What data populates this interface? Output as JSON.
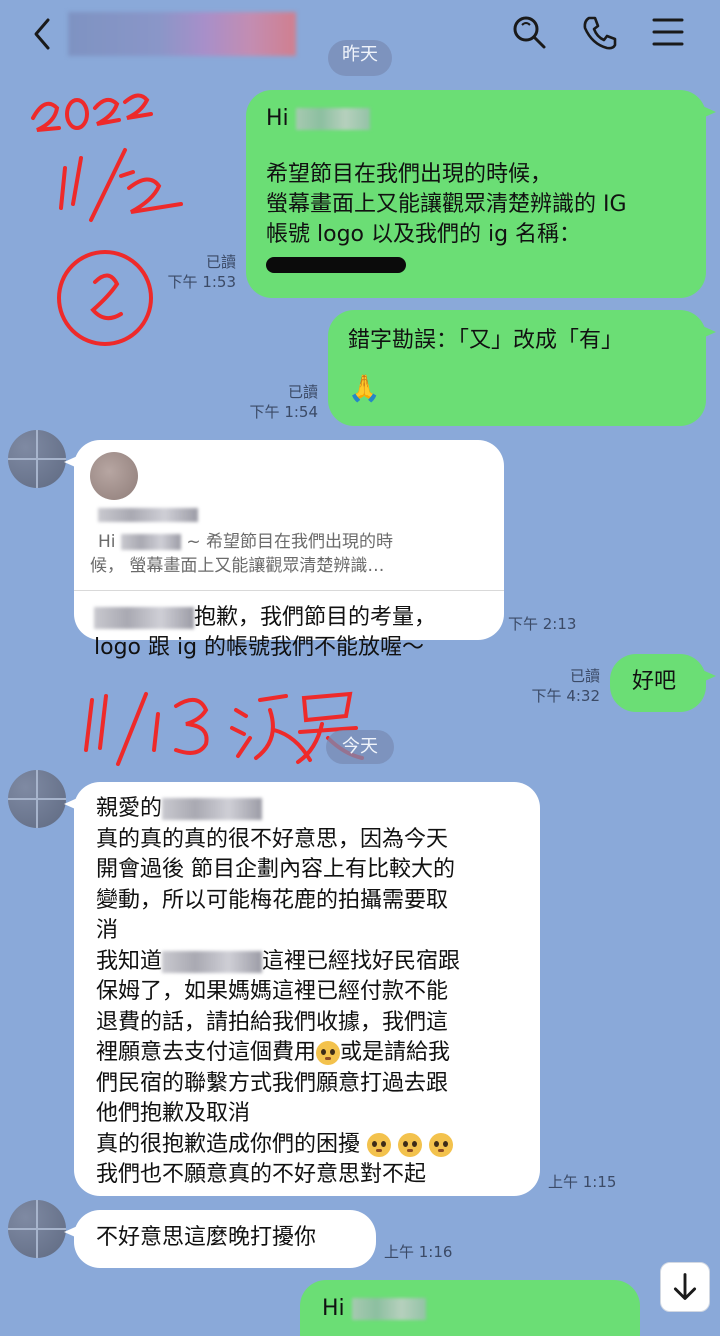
{
  "header": {
    "back_icon": "chevron-left-icon",
    "search_icon": "search-icon",
    "call_icon": "phone-icon",
    "menu_icon": "hamburger-menu-icon"
  },
  "day_separators": {
    "yesterday": "昨天",
    "today": "今天"
  },
  "annotations": {
    "date1": "2022 11/12",
    "date2": "11/13 凌晨"
  },
  "messages": {
    "m1": {
      "greeting": "Hi",
      "line1": "希望節目在我們出現的時候，",
      "line2": "螢幕畫面上又能讓觀眾清楚辨識的 IG",
      "line3": "帳號 logo 以及我們的 ig 名稱：",
      "read": "已讀",
      "time": "下午 1:53"
    },
    "m2": {
      "text": "錯字勘誤：「又」改成「有」",
      "read": "已讀",
      "time": "下午 1:54"
    },
    "m3": {
      "reply_prefix": "Hi",
      "reply_line1": "~ 希望節目在我們出現的時",
      "reply_line2": "候，  螢幕畫面上又能讓觀眾清楚辨識…",
      "line1": "抱歉，我們節目的考量，",
      "line2": "logo 跟 ig 的帳號我們不能放喔～",
      "time": "下午 2:13"
    },
    "m4": {
      "text": "好吧",
      "read": "已讀",
      "time": "下午 4:32"
    },
    "m5": {
      "l1": "親愛的",
      "l2": "真的真的真的很不好意思，因為今天",
      "l3": "開會過後 節目企劃內容上有比較大的",
      "l4": "變動，所以可能梅花鹿的拍攝需要取",
      "l5": "消",
      "l6a": "我知道",
      "l6b": "這裡已經找好民宿跟",
      "l7": "保姆了，如果媽媽這裡已經付款不能",
      "l8": "退費的話，請拍給我們收據，我們這",
      "l9a": "裡願意去支付這個費用",
      "l9b": "或是請給我",
      "l10": "們民宿的聯繫方式我們願意打過去跟",
      "l11": "他們抱歉及取消",
      "l12": "真的很抱歉造成你們的困擾",
      "l13": "我們也不願意真的不好意思對不起",
      "time": "上午 1:15"
    },
    "m6": {
      "text": "不好意思這麼晚打擾你",
      "time": "上午 1:16"
    },
    "m7": {
      "greeting": "Hi"
    }
  },
  "scroll_icon": "arrow-down-icon"
}
